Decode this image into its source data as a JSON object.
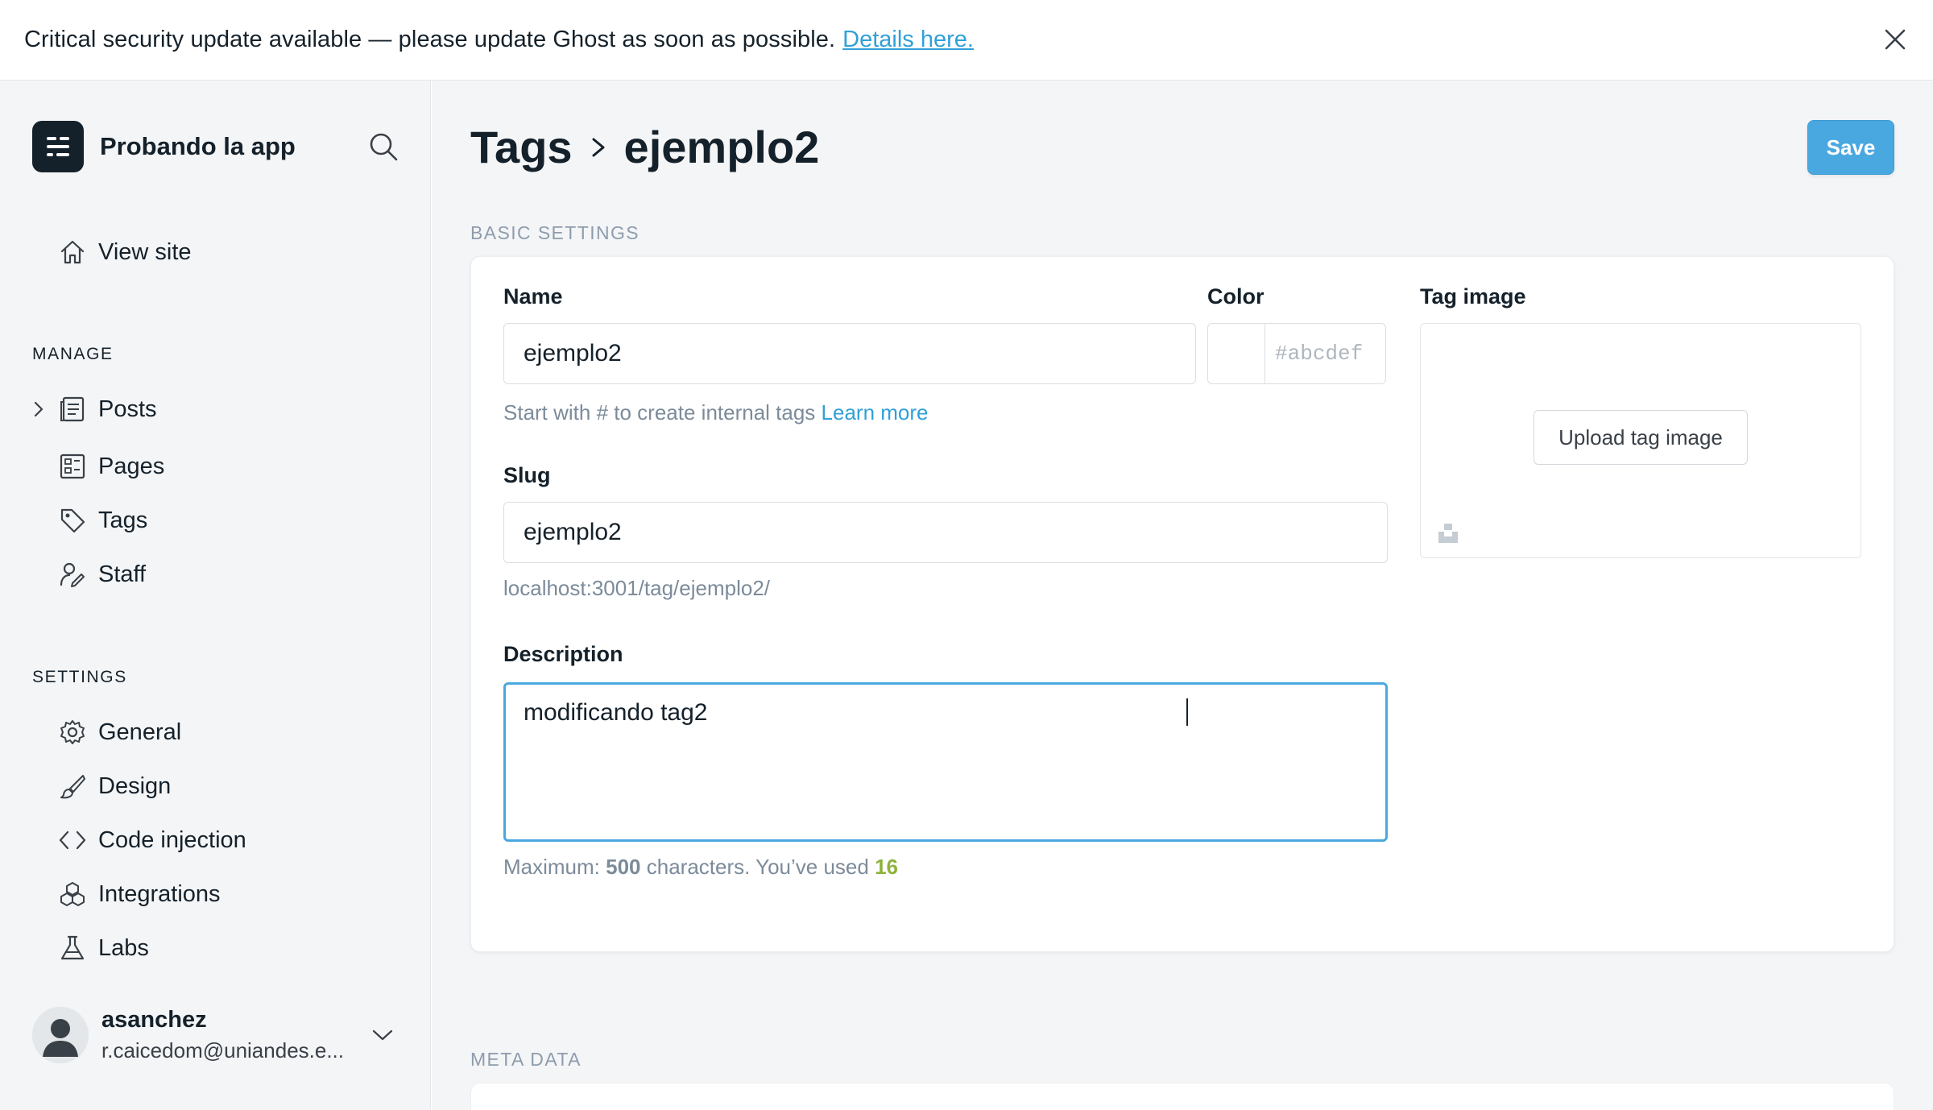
{
  "alert": {
    "message": "Critical security update available — please update Ghost as soon as possible.",
    "link_text": "Details here."
  },
  "sidebar": {
    "brand_name": "Probando la app",
    "view_site": "View site",
    "manage_heading": "MANAGE",
    "manage_items": [
      {
        "label": "Posts",
        "icon": "posts-icon"
      },
      {
        "label": "Pages",
        "icon": "pages-icon"
      },
      {
        "label": "Tags",
        "icon": "tag-icon"
      },
      {
        "label": "Staff",
        "icon": "staff-icon"
      }
    ],
    "settings_heading": "SETTINGS",
    "settings_items": [
      {
        "label": "General",
        "icon": "gear-icon"
      },
      {
        "label": "Design",
        "icon": "brush-icon"
      },
      {
        "label": "Code injection",
        "icon": "code-icon"
      },
      {
        "label": "Integrations",
        "icon": "integrations-icon"
      },
      {
        "label": "Labs",
        "icon": "flask-icon"
      }
    ],
    "user": {
      "name": "asanchez",
      "email": "r.caicedom@uniandes.e..."
    }
  },
  "header": {
    "breadcrumb_parent": "Tags",
    "breadcrumb_current": "ejemplo2",
    "save_label": "Save"
  },
  "basic_settings": {
    "heading": "BASIC SETTINGS",
    "name_label": "Name",
    "name_value": "ejemplo2",
    "name_hint": "Start with # to create internal tags",
    "name_hint_link": "Learn more",
    "color_label": "Color",
    "color_placeholder": "abcdef",
    "color_prefix": "#",
    "slug_label": "Slug",
    "slug_value": "ejemplo2",
    "slug_url": "localhost:3001/tag/ejemplo2/",
    "description_label": "Description",
    "description_value": "modificando tag2",
    "desc_hint_prefix": "Maximum:",
    "desc_max": "500",
    "desc_hint_mid": "characters. You’ve used",
    "desc_used": "16",
    "tag_image_label": "Tag image",
    "upload_label": "Upload tag image"
  },
  "meta": {
    "heading": "META DATA"
  },
  "colors": {
    "accent": "#4aa8e0",
    "link": "#30a0d8",
    "count_used": "#8fb23e",
    "sidebar_bg": "#f4f5f7"
  }
}
